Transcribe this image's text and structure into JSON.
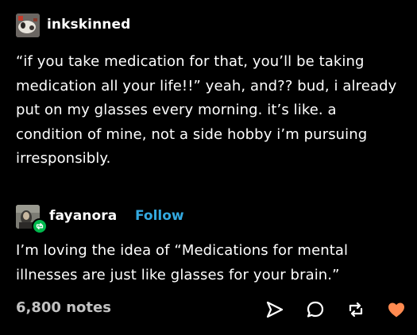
{
  "original_post": {
    "username": "inkskinned",
    "body": "“if you take medication for that, you’ll be taking medication all your life!!” yeah, and?? bud, i already put on my glasses every morning. it’s like. a condition of mine, not a side hobby i’m pursuing irresponsibly."
  },
  "reblog": {
    "username": "fayanora",
    "follow_label": "Follow",
    "body": "I’m loving the idea of “Medications for mental illnesses are just like glasses for your brain.”"
  },
  "footer": {
    "notes": "6,800 notes",
    "icons": [
      "share-icon",
      "reply-icon",
      "reblog-icon",
      "like-heart-icon"
    ]
  },
  "colors": {
    "background": "#000000",
    "text": "#ffffff",
    "follow": "#33a9e0",
    "notes": "#c2c2c2",
    "reblog_badge": "#00b84d",
    "heart": "#ff8a50"
  }
}
